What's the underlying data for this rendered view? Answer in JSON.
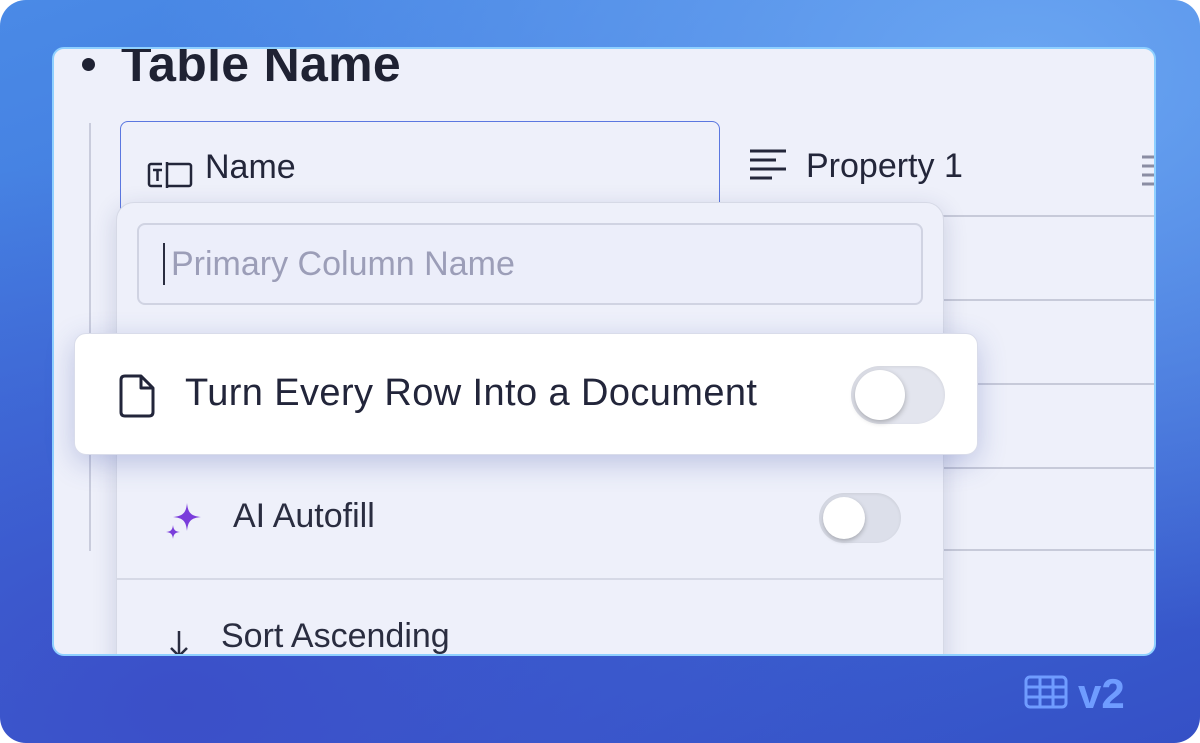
{
  "table": {
    "title": "Table Name",
    "columns": [
      {
        "icon": "text-column-icon",
        "label": "Name"
      },
      {
        "icon": "align-left-icon",
        "label": "Property 1"
      }
    ]
  },
  "menu": {
    "search": {
      "placeholder": "Primary Column Name",
      "value": ""
    },
    "items": [
      {
        "icon": "document-icon",
        "label": "Turn Every Row Into a Document",
        "toggle_on": false
      },
      {
        "icon": "sparkle-icon",
        "label": "AI Autofill",
        "toggle_on": false
      },
      {
        "icon": "arrow-down-icon",
        "label": "Sort Ascending"
      }
    ]
  },
  "badge": {
    "icon": "table-icon",
    "label": "v2"
  },
  "colors": {
    "accent": "#5b77e0",
    "sparkle": "#7a3ddb",
    "version": "#6f9cff"
  }
}
